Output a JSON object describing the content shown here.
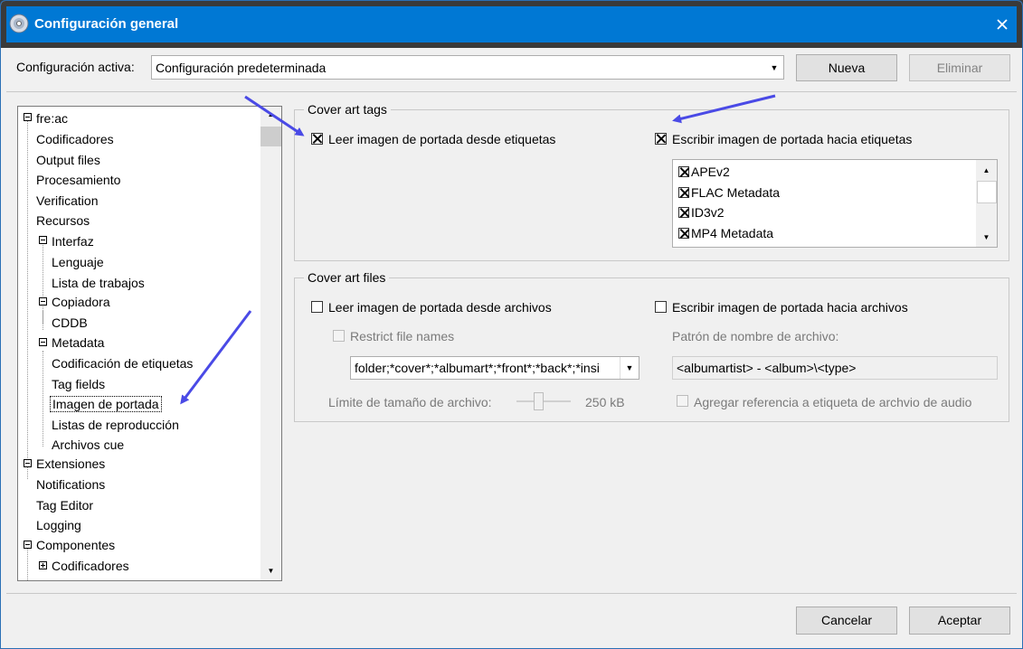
{
  "window": {
    "title": "Configuración general"
  },
  "config": {
    "active_label": "Configuración activa:",
    "selected": "Configuración predeterminada",
    "new_button": "Nueva",
    "delete_button": "Eliminar"
  },
  "tree": {
    "items": [
      {
        "label": "fre:ac"
      },
      {
        "label": "Codificadores"
      },
      {
        "label": "Output files"
      },
      {
        "label": "Procesamiento"
      },
      {
        "label": "Verification"
      },
      {
        "label": "Recursos"
      },
      {
        "label": "Interfaz"
      },
      {
        "label": "Lenguaje"
      },
      {
        "label": "Lista de trabajos"
      },
      {
        "label": "Copiadora"
      },
      {
        "label": "CDDB"
      },
      {
        "label": "Metadata"
      },
      {
        "label": "Codificación de etiquetas"
      },
      {
        "label": "Tag fields"
      },
      {
        "label": "Imagen de portada"
      },
      {
        "label": "Listas de reproducción"
      },
      {
        "label": "Archivos cue"
      },
      {
        "label": "Extensiones"
      },
      {
        "label": "Notifications"
      },
      {
        "label": "Tag Editor"
      },
      {
        "label": "Logging"
      },
      {
        "label": "Componentes"
      },
      {
        "label": "Codificadores"
      }
    ]
  },
  "cover_tags": {
    "title": "Cover art tags",
    "read_label": "Leer imagen de portada desde etiquetas",
    "read_checked": true,
    "write_label": "Escribir imagen de portada hacia etiquetas",
    "write_checked": true,
    "formats": [
      {
        "label": "APEv2",
        "checked": true
      },
      {
        "label": "FLAC Metadata",
        "checked": true
      },
      {
        "label": "ID3v2",
        "checked": true
      },
      {
        "label": "MP4 Metadata",
        "checked": true
      }
    ]
  },
  "cover_files": {
    "title": "Cover art files",
    "read_label": "Leer imagen de portada desde archivos",
    "write_label": "Escribir imagen de portada hacia archivos",
    "restrict_label": "Restrict file names",
    "pattern_label": "Patrón de nombre de archivo:",
    "names_value": "folder;*cover*;*albumart*;*front*;*back*;*insi",
    "pattern_value": "<albumartist> - <album>\\<type>",
    "size_limit_label": "Límite de tamaño de archivo:",
    "size_limit_value": "250 kB",
    "audio_ref_label": "Agregar referencia a etiqueta de archvio de audio"
  },
  "footer": {
    "cancel_button": "Cancelar",
    "accept_button": "Aceptar"
  },
  "colors": {
    "titlebar": "#0078d4",
    "annotation_arrow": "#4a4ae6"
  }
}
